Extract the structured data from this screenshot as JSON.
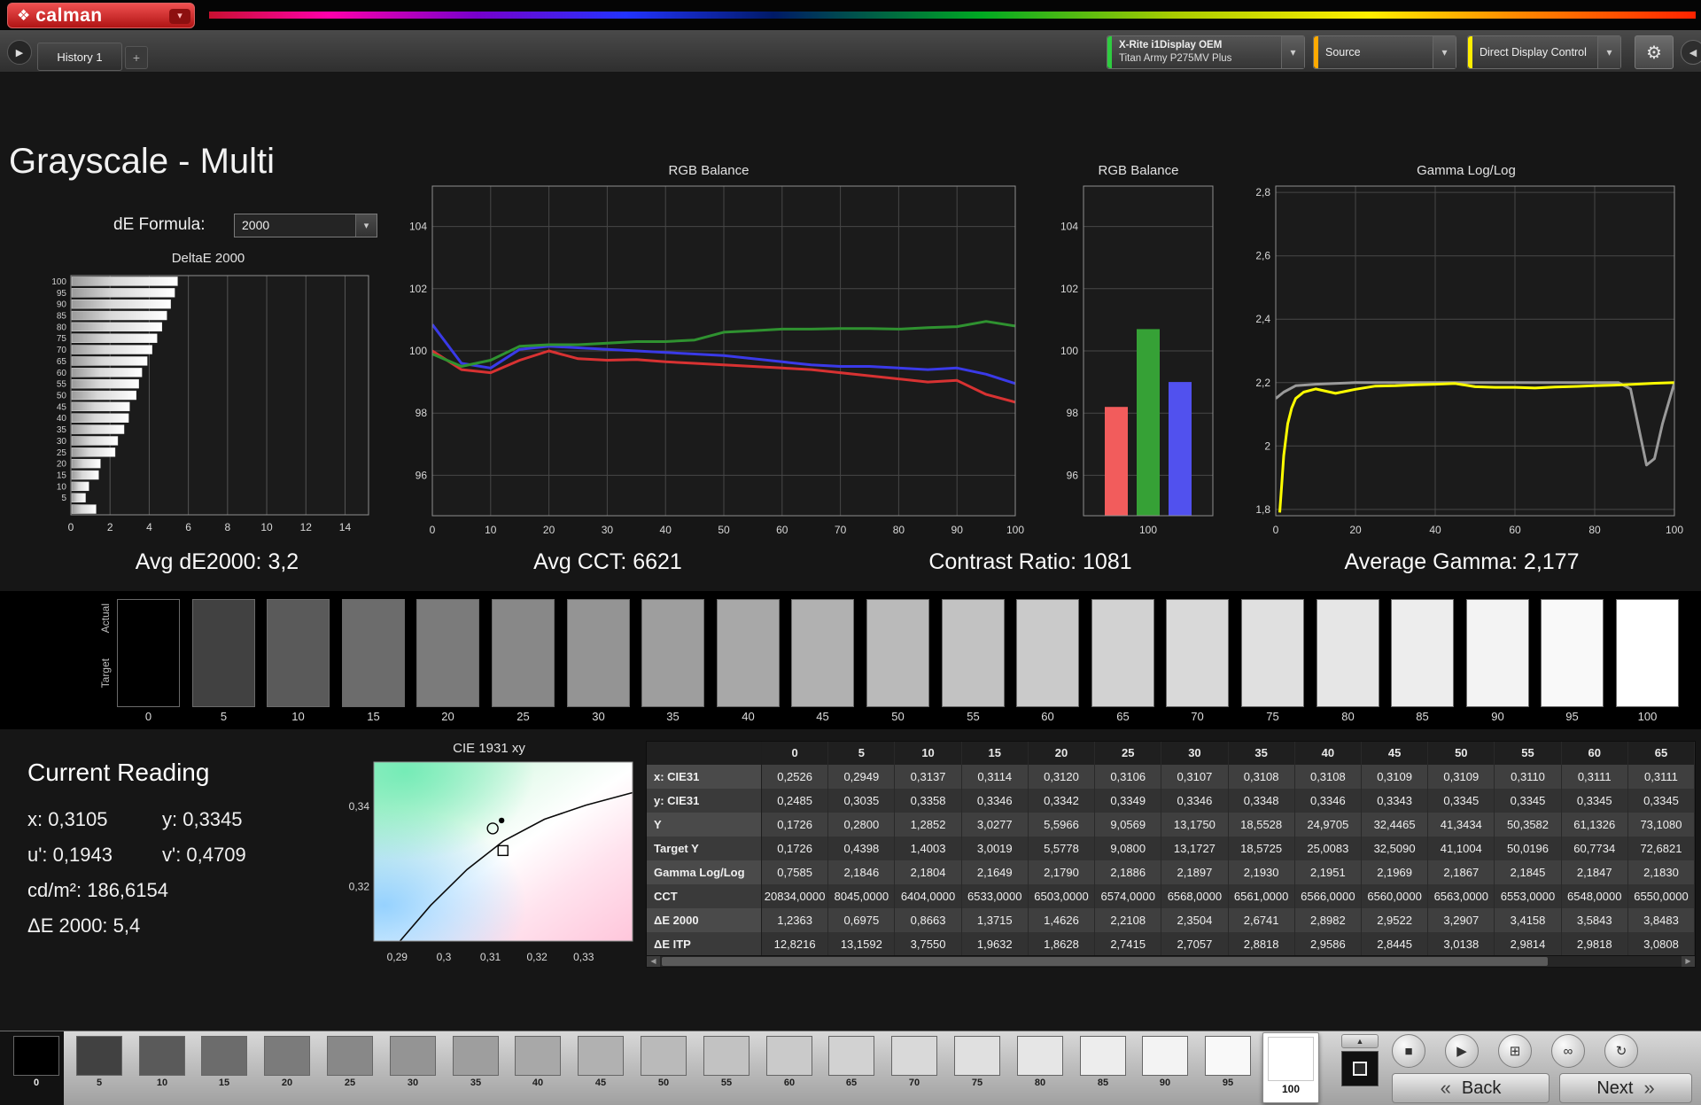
{
  "icons": {
    "logo_mark": "❖",
    "dropdown_arrow": "▾",
    "gear": "⚙",
    "play": "▶",
    "plus": "+",
    "stop": "■",
    "pattern_window": "⊞",
    "continuous": "∞",
    "refresh": "↻",
    "up_arrow": "▲",
    "back_chevrons": "«",
    "next_chevrons": "»",
    "left_arrow": "◀",
    "scroll_left": "◀",
    "scroll_right": "▶"
  },
  "topbar": {
    "logo_text": "calman"
  },
  "toolbar": {
    "history_tab": "History 1",
    "meter_line1": "X-Rite i1Display OEM",
    "meter_line2": "Titan Army P275MV Plus",
    "source_label": "Source",
    "display_control_label": "Direct Display Control"
  },
  "page": {
    "title": "Grayscale - Multi",
    "de_formula_label": "dE Formula:",
    "de_formula_value": "2000"
  },
  "stats": {
    "avg_de": "Avg dE2000: 3,2",
    "avg_cct": "Avg CCT: 6621",
    "contrast": "Contrast Ratio: 1081",
    "avg_gamma": "Average Gamma: 2,177"
  },
  "grayscale_strip": {
    "actual_label": "Actual",
    "target_label": "Target",
    "values": [
      0,
      5,
      10,
      15,
      20,
      25,
      30,
      35,
      40,
      45,
      50,
      55,
      60,
      65,
      70,
      75,
      80,
      85,
      90,
      95,
      100
    ],
    "labels": [
      "0",
      "5",
      "10",
      "15",
      "20",
      "25",
      "30",
      "35",
      "40",
      "45",
      "50",
      "55",
      "60",
      "65",
      "70",
      "75",
      "80",
      "85",
      "90",
      "95",
      "100"
    ]
  },
  "current_reading": {
    "title": "Current Reading",
    "x": "x: 0,3105",
    "y": "y: 0,3345",
    "u": "u': 0,1943",
    "v": "v': 0,4709",
    "luminance": "cd/m²: 186,6154",
    "delta_e": "ΔE 2000: 5,4"
  },
  "table": {
    "columns": [
      "0",
      "5",
      "10",
      "15",
      "20",
      "25",
      "30",
      "35",
      "40",
      "45",
      "50",
      "55",
      "60",
      "65"
    ],
    "rows": [
      {
        "label": "x: CIE31",
        "values": [
          "0,2526",
          "0,2949",
          "0,3137",
          "0,3114",
          "0,3120",
          "0,3106",
          "0,3107",
          "0,3108",
          "0,3108",
          "0,3109",
          "0,3109",
          "0,3110",
          "0,3111",
          "0,3111"
        ]
      },
      {
        "label": "y: CIE31",
        "values": [
          "0,2485",
          "0,3035",
          "0,3358",
          "0,3346",
          "0,3342",
          "0,3349",
          "0,3346",
          "0,3348",
          "0,3346",
          "0,3343",
          "0,3345",
          "0,3345",
          "0,3345",
          "0,3345"
        ]
      },
      {
        "label": "Y",
        "values": [
          "0,1726",
          "0,2800",
          "1,2852",
          "3,0277",
          "5,5966",
          "9,0569",
          "13,1750",
          "18,5528",
          "24,9705",
          "32,4465",
          "41,3434",
          "50,3582",
          "61,1326",
          "73,1080"
        ]
      },
      {
        "label": "Target Y",
        "values": [
          "0,1726",
          "0,4398",
          "1,4003",
          "3,0019",
          "5,5778",
          "9,0800",
          "13,1727",
          "18,5725",
          "25,0083",
          "32,5090",
          "41,1004",
          "50,0196",
          "60,7734",
          "72,6821"
        ]
      },
      {
        "label": "Gamma Log/Log",
        "values": [
          "0,7585",
          "2,1846",
          "2,1804",
          "2,1649",
          "2,1790",
          "2,1886",
          "2,1897",
          "2,1930",
          "2,1951",
          "2,1969",
          "2,1867",
          "2,1845",
          "2,1847",
          "2,1830"
        ]
      },
      {
        "label": "CCT",
        "values": [
          "20834,0000",
          "8045,0000",
          "6404,0000",
          "6533,0000",
          "6503,0000",
          "6574,0000",
          "6568,0000",
          "6561,0000",
          "6566,0000",
          "6560,0000",
          "6563,0000",
          "6553,0000",
          "6548,0000",
          "6550,0000"
        ]
      },
      {
        "label": "ΔE 2000",
        "values": [
          "1,2363",
          "0,6975",
          "0,8663",
          "1,3715",
          "1,4626",
          "2,2108",
          "2,3504",
          "2,6741",
          "2,8982",
          "2,9522",
          "3,2907",
          "3,4158",
          "3,5843",
          "3,8483"
        ]
      },
      {
        "label": "ΔE ITP",
        "values": [
          "12,8216",
          "13,1592",
          "3,7550",
          "1,9632",
          "1,8628",
          "2,7415",
          "2,7057",
          "2,8818",
          "2,9586",
          "2,8445",
          "3,0138",
          "2,9814",
          "2,9818",
          "3,0808"
        ]
      }
    ]
  },
  "chart_data": [
    {
      "id": "deltae",
      "type": "bar",
      "orientation": "horizontal",
      "title": "DeltaE 2000",
      "categories": [
        100,
        95,
        90,
        85,
        80,
        75,
        70,
        65,
        60,
        55,
        50,
        45,
        40,
        35,
        30,
        25,
        20,
        15,
        10,
        5,
        0
      ],
      "values": [
        5.4,
        5.25,
        5.05,
        4.85,
        4.6,
        4.35,
        4.1,
        3.85,
        3.58,
        3.42,
        3.29,
        2.95,
        2.9,
        2.67,
        2.35,
        2.21,
        1.46,
        1.37,
        0.87,
        0.7,
        1.24
      ],
      "xlim": [
        0,
        15.2
      ],
      "xticks": [
        0,
        2,
        4,
        6,
        8,
        10,
        12,
        14
      ]
    },
    {
      "id": "rgb-line",
      "type": "line",
      "title": "RGB Balance",
      "x": [
        0,
        5,
        10,
        15,
        20,
        25,
        30,
        35,
        40,
        45,
        50,
        55,
        60,
        65,
        70,
        75,
        80,
        85,
        90,
        95,
        100
      ],
      "xlim": [
        0,
        100
      ],
      "xticks": [
        0,
        10,
        20,
        30,
        40,
        50,
        60,
        70,
        80,
        90,
        100
      ],
      "ylim": [
        94.7,
        105.3
      ],
      "yticks": [
        96,
        98,
        100,
        102,
        104
      ],
      "series": [
        {
          "name": "Red",
          "color": "#d83232",
          "values": [
            100.0,
            99.4,
            99.3,
            99.7,
            100.0,
            99.75,
            99.7,
            99.72,
            99.65,
            99.6,
            99.55,
            99.5,
            99.45,
            99.4,
            99.3,
            99.2,
            99.1,
            99.0,
            99.05,
            98.6,
            98.35
          ]
        },
        {
          "name": "Blue",
          "color": "#3a3ae8",
          "values": [
            100.85,
            99.6,
            99.45,
            100.05,
            100.15,
            100.1,
            100.05,
            100.0,
            99.95,
            99.9,
            99.85,
            99.75,
            99.65,
            99.55,
            99.5,
            99.5,
            99.45,
            99.4,
            99.45,
            99.25,
            98.95
          ]
        },
        {
          "name": "Green",
          "color": "#2f9230",
          "values": [
            99.9,
            99.5,
            99.7,
            100.15,
            100.2,
            100.2,
            100.25,
            100.3,
            100.3,
            100.35,
            100.6,
            100.65,
            100.7,
            100.7,
            100.72,
            100.72,
            100.7,
            100.75,
            100.78,
            100.95,
            100.8
          ]
        }
      ]
    },
    {
      "id": "rgb-bar",
      "type": "bar",
      "title": "RGB Balance",
      "categories": [
        "Red",
        "Green",
        "Blue"
      ],
      "values": [
        98.2,
        100.7,
        99.0
      ],
      "colors": [
        "#f25c5c",
        "#36a136",
        "#5151ee"
      ],
      "ylim": [
        94.7,
        105.3
      ],
      "yticks": [
        96,
        98,
        100,
        102,
        104
      ],
      "xtick_label": "100"
    },
    {
      "id": "gamma",
      "type": "line",
      "title": "Gamma Log/Log",
      "xlim": [
        0,
        100
      ],
      "xticks": [
        0,
        20,
        40,
        60,
        80,
        100
      ],
      "ylim": [
        1.78,
        2.82
      ],
      "yticks": [
        1.8,
        2.0,
        2.2,
        2.4,
        2.6,
        2.8
      ],
      "ytick_labels": [
        "1,8",
        "2",
        "2,2",
        "2,4",
        "2,6",
        "2,8"
      ],
      "series": [
        {
          "name": "Reference",
          "color": "#9a9a9a",
          "points": [
            [
              0,
              2.15
            ],
            [
              2,
              2.17
            ],
            [
              5,
              2.19
            ],
            [
              10,
              2.195
            ],
            [
              20,
              2.2
            ],
            [
              30,
              2.2
            ],
            [
              40,
              2.2
            ],
            [
              50,
              2.2
            ],
            [
              60,
              2.2
            ],
            [
              70,
              2.2
            ],
            [
              80,
              2.2
            ],
            [
              86,
              2.2
            ],
            [
              89,
              2.18
            ],
            [
              93,
              1.94
            ],
            [
              95,
              1.96
            ],
            [
              97,
              2.07
            ],
            [
              100,
              2.2
            ]
          ]
        },
        {
          "name": "Measured",
          "color": "#ffff00",
          "points": [
            [
              1,
              1.79
            ],
            [
              1.5,
              1.88
            ],
            [
              2,
              1.97
            ],
            [
              3,
              2.07
            ],
            [
              4,
              2.12
            ],
            [
              5,
              2.15
            ],
            [
              7,
              2.17
            ],
            [
              10,
              2.18
            ],
            [
              15,
              2.166
            ],
            [
              20,
              2.179
            ],
            [
              25,
              2.189
            ],
            [
              30,
              2.19
            ],
            [
              35,
              2.193
            ],
            [
              40,
              2.195
            ],
            [
              45,
              2.197
            ],
            [
              50,
              2.187
            ],
            [
              55,
              2.185
            ],
            [
              60,
              2.185
            ],
            [
              65,
              2.183
            ],
            [
              70,
              2.186
            ],
            [
              75,
              2.188
            ],
            [
              80,
              2.19
            ],
            [
              85,
              2.192
            ],
            [
              90,
              2.195
            ],
            [
              95,
              2.198
            ],
            [
              100,
              2.2
            ]
          ]
        }
      ]
    },
    {
      "id": "cie",
      "type": "scatter",
      "title": "CIE 1931 xy",
      "xlim": [
        0.285,
        0.3405
      ],
      "ylim": [
        0.3065,
        0.351
      ],
      "xticks": [
        0.29,
        0.3,
        0.31,
        0.32,
        0.33
      ],
      "xtick_labels": [
        "0,29",
        "0,3",
        "0,31",
        "0,32",
        "0,33"
      ],
      "yticks": [
        0.34,
        0.32
      ],
      "ytick_labels": [
        "0,34",
        "0,32"
      ],
      "actual_xy": [
        0.3105,
        0.3345
      ],
      "target_xy": [
        0.3127,
        0.329
      ],
      "locus": [
        [
          0.2906,
          0.3065
        ],
        [
          0.2972,
          0.3154
        ],
        [
          0.305,
          0.3243
        ],
        [
          0.3128,
          0.3314
        ],
        [
          0.3216,
          0.3368
        ],
        [
          0.3305,
          0.3403
        ],
        [
          0.3405,
          0.3434
        ]
      ]
    }
  ],
  "bottom_bar": {
    "swatch_values": [
      0,
      5,
      10,
      15,
      20,
      25,
      30,
      35,
      40,
      45,
      50,
      55,
      60,
      65,
      70,
      75,
      80,
      85,
      90,
      95,
      100
    ],
    "swatch_labels": [
      "0",
      "5",
      "10",
      "15",
      "20",
      "25",
      "30",
      "35",
      "40",
      "45",
      "50",
      "55",
      "60",
      "65",
      "70",
      "75",
      "80",
      "85",
      "90",
      "95",
      "100"
    ],
    "selected_index": 20,
    "back_label": "Back",
    "next_label": "Next"
  }
}
